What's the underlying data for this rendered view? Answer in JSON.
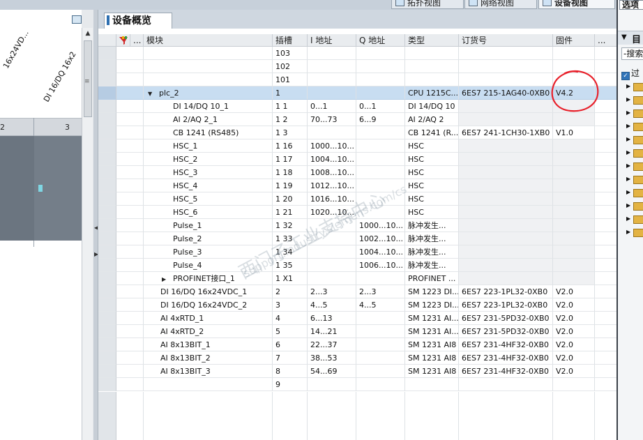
{
  "view_tabs": [
    {
      "label": "拓扑视图",
      "icon": "topology-view-icon"
    },
    {
      "label": "网络视图",
      "icon": "network-view-icon"
    },
    {
      "label": "设备视图",
      "icon": "device-view-icon"
    }
  ],
  "right_pane": {
    "title": "选项",
    "section": "目",
    "search": "-搜索",
    "filter": "过"
  },
  "canvas": {
    "rotated_labels": [
      "16x24VD...",
      "DI 16/DQ 16x2"
    ],
    "slots": [
      "2",
      "3"
    ]
  },
  "overview": {
    "title": "设备概览",
    "columns": {
      "module": "模块",
      "slot": "插槽",
      "i_addr": "I 地址",
      "q_addr": "Q 地址",
      "type": "类型",
      "order": "订货号",
      "firmware": "固件",
      "more": "...",
      "dots": "..."
    },
    "rows": [
      {
        "module": "",
        "slot": "103",
        "i": "",
        "q": "",
        "type": "",
        "order": "",
        "fw": ""
      },
      {
        "module": "",
        "slot": "102",
        "i": "",
        "q": "",
        "type": "",
        "order": "",
        "fw": ""
      },
      {
        "module": "",
        "slot": "101",
        "i": "",
        "q": "",
        "type": "",
        "order": "",
        "fw": ""
      },
      {
        "module": "plc_2",
        "slot": "1",
        "i": "",
        "q": "",
        "type": "CPU 1215C...",
        "order": "6ES7 215-1AG40-0XB0",
        "fw": "V4.2"
      },
      {
        "module": "DI 14/DQ 10_1",
        "slot": "1 1",
        "i": "0...1",
        "q": "0...1",
        "type": "DI 14/DQ 10",
        "order": "",
        "fw": ""
      },
      {
        "module": "AI 2/AQ 2_1",
        "slot": "1 2",
        "i": "70...73",
        "q": "6...9",
        "type": "AI 2/AQ 2",
        "order": "",
        "fw": ""
      },
      {
        "module": "CB 1241 (RS485)",
        "slot": "1 3",
        "i": "",
        "q": "",
        "type": "CB 1241 (R...",
        "order": "6ES7 241-1CH30-1XB0",
        "fw": "V1.0"
      },
      {
        "module": "HSC_1",
        "slot": "1 16",
        "i": "1000...10...",
        "q": "",
        "type": "HSC",
        "order": "",
        "fw": ""
      },
      {
        "module": "HSC_2",
        "slot": "1 17",
        "i": "1004...10...",
        "q": "",
        "type": "HSC",
        "order": "",
        "fw": ""
      },
      {
        "module": "HSC_3",
        "slot": "1 18",
        "i": "1008...10...",
        "q": "",
        "type": "HSC",
        "order": "",
        "fw": ""
      },
      {
        "module": "HSC_4",
        "slot": "1 19",
        "i": "1012...10...",
        "q": "",
        "type": "HSC",
        "order": "",
        "fw": ""
      },
      {
        "module": "HSC_5",
        "slot": "1 20",
        "i": "1016...10...",
        "q": "",
        "type": "HSC",
        "order": "",
        "fw": ""
      },
      {
        "module": "HSC_6",
        "slot": "1 21",
        "i": "1020...10...",
        "q": "",
        "type": "HSC",
        "order": "",
        "fw": ""
      },
      {
        "module": "Pulse_1",
        "slot": "1 32",
        "i": "",
        "q": "1000...10...",
        "type": "脉冲发生...",
        "order": "",
        "fw": ""
      },
      {
        "module": "Pulse_2",
        "slot": "1 33",
        "i": "",
        "q": "1002...10...",
        "type": "脉冲发生...",
        "order": "",
        "fw": ""
      },
      {
        "module": "Pulse_3",
        "slot": "1 34",
        "i": "",
        "q": "1004...10...",
        "type": "脉冲发生...",
        "order": "",
        "fw": ""
      },
      {
        "module": "Pulse_4",
        "slot": "1 35",
        "i": "",
        "q": "1006...10...",
        "type": "脉冲发生...",
        "order": "",
        "fw": ""
      },
      {
        "module": "PROFINET接口_1",
        "slot": "1 X1",
        "i": "",
        "q": "",
        "type": "PROFINET ...",
        "order": "",
        "fw": ""
      },
      {
        "module": "DI 16/DQ 16x24VDC_1",
        "slot": "2",
        "i": "2...3",
        "q": "2...3",
        "type": "SM 1223 DI...",
        "order": "6ES7 223-1PL32-0XB0",
        "fw": "V2.0"
      },
      {
        "module": "DI 16/DQ 16x24VDC_2",
        "slot": "3",
        "i": "4...5",
        "q": "4...5",
        "type": "SM 1223 DI...",
        "order": "6ES7 223-1PL32-0XB0",
        "fw": "V2.0"
      },
      {
        "module": "AI 4xRTD_1",
        "slot": "4",
        "i": "6...13",
        "q": "",
        "type": "SM 1231 AI...",
        "order": "6ES7 231-5PD32-0XB0",
        "fw": "V2.0"
      },
      {
        "module": "AI 4xRTD_2",
        "slot": "5",
        "i": "14...21",
        "q": "",
        "type": "SM 1231 AI...",
        "order": "6ES7 231-5PD32-0XB0",
        "fw": "V2.0"
      },
      {
        "module": "AI 8x13BIT_1",
        "slot": "6",
        "i": "22...37",
        "q": "",
        "type": "SM 1231 AI8",
        "order": "6ES7 231-4HF32-0XB0",
        "fw": "V2.0"
      },
      {
        "module": "AI 8x13BIT_2",
        "slot": "7",
        "i": "38...53",
        "q": "",
        "type": "SM 1231 AI8",
        "order": "6ES7 231-4HF32-0XB0",
        "fw": "V2.0"
      },
      {
        "module": "AI 8x13BIT_3",
        "slot": "8",
        "i": "54...69",
        "q": "",
        "type": "SM 1231 AI8",
        "order": "6ES7 231-4HF32-0XB0",
        "fw": "V2.0"
      },
      {
        "module": "",
        "slot": "9",
        "i": "",
        "q": "",
        "type": "",
        "order": "",
        "fw": ""
      }
    ]
  },
  "watermark": "西门子工业支持中心",
  "watermark_url": "support.industry.siemens.com/cs",
  "colors": {
    "selection": "#c8ddf1",
    "annotation": "#e8202a",
    "header_bg": "#e9ecef"
  }
}
